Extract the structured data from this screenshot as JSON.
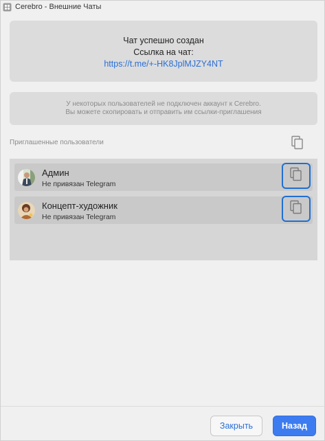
{
  "window": {
    "title": "Cerebro - Внешние Чаты",
    "app_icon": "cerebro-logo-icon"
  },
  "success": {
    "line1": "Чат успешно создан",
    "line2": "Ссылка на чат:",
    "link": "https://t.me/+-HK8JplMJZY4NT"
  },
  "notice": {
    "line1": "У некоторых пользователей не подключен аккаунт к Cerebro.",
    "line2": "Вы можете скопировать и отправить им ссылки-приглашения"
  },
  "invited": {
    "label": "Приглашенные пользователи",
    "copy_all_icon": "copy-icon"
  },
  "users": [
    {
      "name": "Админ",
      "status": "Не привязан Telegram",
      "copy_icon": "copy-icon"
    },
    {
      "name": "Концепт-художник",
      "status": "Не привязан Telegram",
      "copy_icon": "copy-icon"
    }
  ],
  "footer": {
    "close_label": "Закрыть",
    "back_label": "Назад"
  },
  "colors": {
    "accent": "#3d7cf0",
    "link": "#2a6fd6",
    "focus_border": "#1f6fd1"
  }
}
